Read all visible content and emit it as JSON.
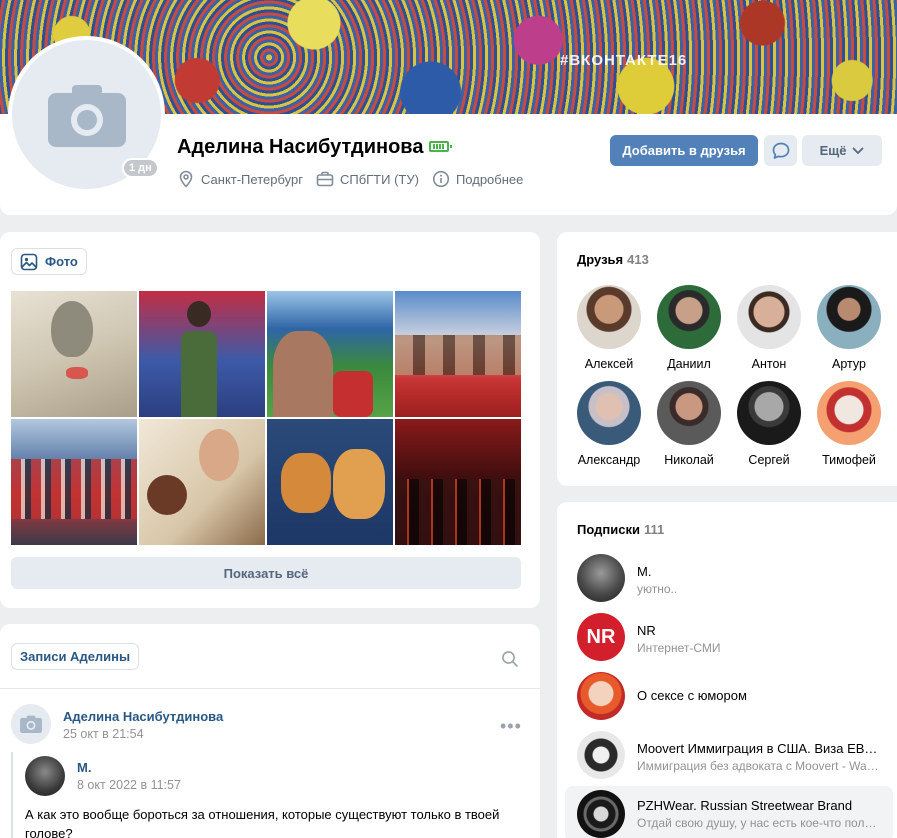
{
  "cover": {
    "tag": "#ВКОНТАКТЕ16"
  },
  "profile": {
    "name": "Аделина Насибутдинова",
    "online_badge": "1 дн",
    "city": "Санкт-Петербург",
    "university": "СПбГТИ (ТУ)",
    "details_label": "Подробнее",
    "add_friend_label": "Добавить в друзья",
    "more_label": "Ещё"
  },
  "photos": {
    "label": "Фото",
    "show_all_label": "Показать всё"
  },
  "posts": {
    "label": "Записи Аделины",
    "items": [
      {
        "author": "Аделина Насибутдинова",
        "date": "25 окт в 21:54",
        "repost": {
          "author": "М.",
          "date": "8 окт 2022 в 11:57",
          "text": "А как это вообще бороться за отношения, которые существуют только в твоей голове?"
        }
      }
    ]
  },
  "friends": {
    "title": "Друзья",
    "count": "413",
    "items": [
      {
        "name": "Алексей"
      },
      {
        "name": "Даниил"
      },
      {
        "name": "Антон"
      },
      {
        "name": "Артур"
      },
      {
        "name": "Александр"
      },
      {
        "name": "Николай"
      },
      {
        "name": "Сергей"
      },
      {
        "name": "Тимофей"
      }
    ]
  },
  "subscriptions": {
    "title": "Подписки",
    "count": "111",
    "items": [
      {
        "title": "М.",
        "subtitle": "уютно.."
      },
      {
        "title": "NR",
        "subtitle": "Интернет-СМИ",
        "avatar_text": "NR"
      },
      {
        "title": "О сексе с юмором",
        "subtitle": ""
      },
      {
        "title": "Moovert Иммиграция в США. Виза EB-…",
        "subtitle": "Иммиграция без адвоката с Moovert - Wa…"
      },
      {
        "title": "PZHWear. Russian Streetwear Brand",
        "subtitle": "Отдай свою душу, у нас есть кое-что полу…"
      }
    ]
  },
  "colors": {
    "accent": "#5181b8",
    "link": "#2a5885",
    "secondary_button_bg": "#e5ebf1",
    "background": "#edeef0"
  }
}
